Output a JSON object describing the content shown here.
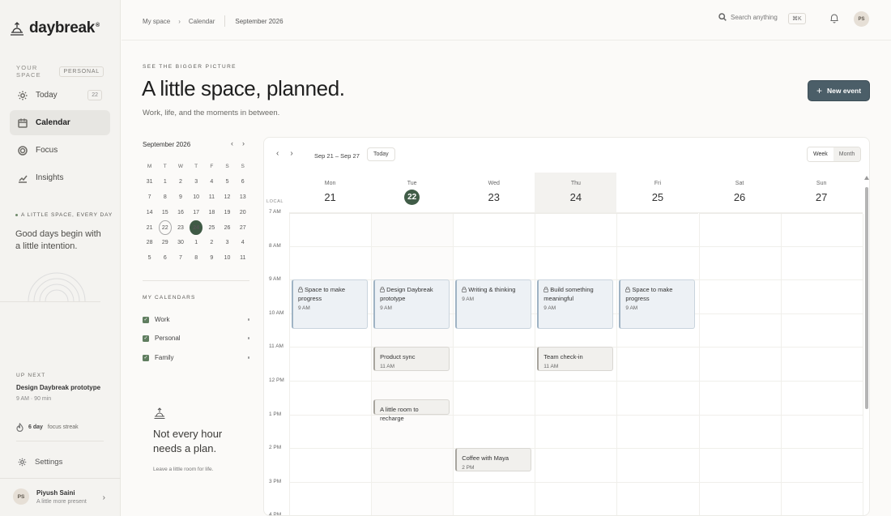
{
  "app": {
    "name": "daybreak",
    "reg": "®"
  },
  "sidebar": {
    "space_label": "YOUR SPACE",
    "space_badge": "PERSONAL",
    "items": [
      {
        "label": "Today",
        "icon": "sun-icon",
        "count": "22"
      },
      {
        "label": "Calendar",
        "icon": "calendar-icon",
        "active": true
      },
      {
        "label": "Focus",
        "icon": "target-icon"
      },
      {
        "label": "Insights",
        "icon": "chart-icon"
      }
    ],
    "tagline": "A LITTLE SPACE, EVERY DAY",
    "quote": "Good days begin with a little intention.",
    "upnext_label": "UP NEXT",
    "upnext_title": "Design Daybreak prototype",
    "upnext_meta": "9 AM · 90 min",
    "streak_count": "6 day",
    "streak_text": "focus streak",
    "settings": "Settings",
    "user": {
      "initials": "PS",
      "name": "Piyush Saini",
      "sub": "A little more present"
    }
  },
  "topbar": {
    "crumbs": [
      "My space",
      "Calendar"
    ],
    "current": "September 2026",
    "search_placeholder": "Search anything",
    "shortcut": "⌘K",
    "avatar": "PS"
  },
  "header": {
    "eyebrow": "SEE THE BIGGER PICTURE",
    "title": "A little space, planned.",
    "subtitle": "Work, life, and the moments in between.",
    "new_event": "New event"
  },
  "mini_calendar": {
    "title": "September 2026",
    "weekdays": [
      "M",
      "T",
      "W",
      "T",
      "F",
      "S",
      "S"
    ],
    "weeks": [
      [
        "31",
        "1",
        "2",
        "3",
        "4",
        "5",
        "6"
      ],
      [
        "7",
        "8",
        "9",
        "10",
        "11",
        "12",
        "13"
      ],
      [
        "14",
        "15",
        "16",
        "17",
        "18",
        "19",
        "20"
      ],
      [
        "21",
        "22",
        "23",
        "24",
        "25",
        "26",
        "27"
      ],
      [
        "28",
        "29",
        "30",
        "1",
        "2",
        "3",
        "4"
      ],
      [
        "5",
        "6",
        "7",
        "8",
        "9",
        "10",
        "11"
      ]
    ],
    "today": "22",
    "selected": "24"
  },
  "my_calendars": {
    "label": "MY CALENDARS",
    "items": [
      "Work",
      "Personal",
      "Family"
    ]
  },
  "promo": {
    "title": "Not every hour needs a plan.",
    "sub": "Leave a little room for life."
  },
  "calendar": {
    "range": "Sep 21 – Sep 27",
    "today_label": "Today",
    "views": [
      "Week",
      "Month"
    ],
    "active_view": "Week",
    "local_label": "LOCAL",
    "days": [
      {
        "name": "Mon",
        "date": "21"
      },
      {
        "name": "Tue",
        "date": "22",
        "today": true
      },
      {
        "name": "Wed",
        "date": "23"
      },
      {
        "name": "Thu",
        "date": "24",
        "highlight": true
      },
      {
        "name": "Fri",
        "date": "25"
      },
      {
        "name": "Sat",
        "date": "26"
      },
      {
        "name": "Sun",
        "date": "27"
      }
    ],
    "hours": [
      "7 AM",
      "8 AM",
      "9 AM",
      "10 AM",
      "11 AM",
      "12 PM",
      "1 PM",
      "2 PM",
      "3 PM",
      "4 PM"
    ],
    "events": [
      {
        "day": 0,
        "title": "Space to make progress",
        "time": "9 AM",
        "style": "blue",
        "locked": true,
        "start": 9,
        "end": 10.45
      },
      {
        "day": 1,
        "title": "Design Daybreak prototype",
        "time": "9 AM",
        "style": "blue",
        "locked": true,
        "start": 9,
        "end": 10.45
      },
      {
        "day": 2,
        "title": "Writing & thinking",
        "time": "9 AM",
        "style": "blue",
        "locked": true,
        "start": 9,
        "end": 10.45
      },
      {
        "day": 3,
        "title": "Build something meaningful",
        "time": "9 AM",
        "style": "blue",
        "locked": true,
        "start": 9,
        "end": 10.45
      },
      {
        "day": 4,
        "title": "Space to make progress",
        "time": "9 AM",
        "style": "blue",
        "locked": true,
        "start": 9,
        "end": 10.45
      },
      {
        "day": 1,
        "title": "Product sync",
        "time": "11 AM",
        "style": "grey",
        "start": 11,
        "end": 11.7
      },
      {
        "day": 3,
        "title": "Team check-in",
        "time": "11 AM",
        "style": "grey",
        "start": 11,
        "end": 11.7
      },
      {
        "day": 1,
        "title": "A little room to recharge",
        "time": "",
        "style": "grey",
        "start": 12.55,
        "end": 13
      },
      {
        "day": 2,
        "title": "Coffee with Maya",
        "time": "2 PM",
        "style": "grey",
        "start": 14,
        "end": 14.7
      }
    ]
  }
}
